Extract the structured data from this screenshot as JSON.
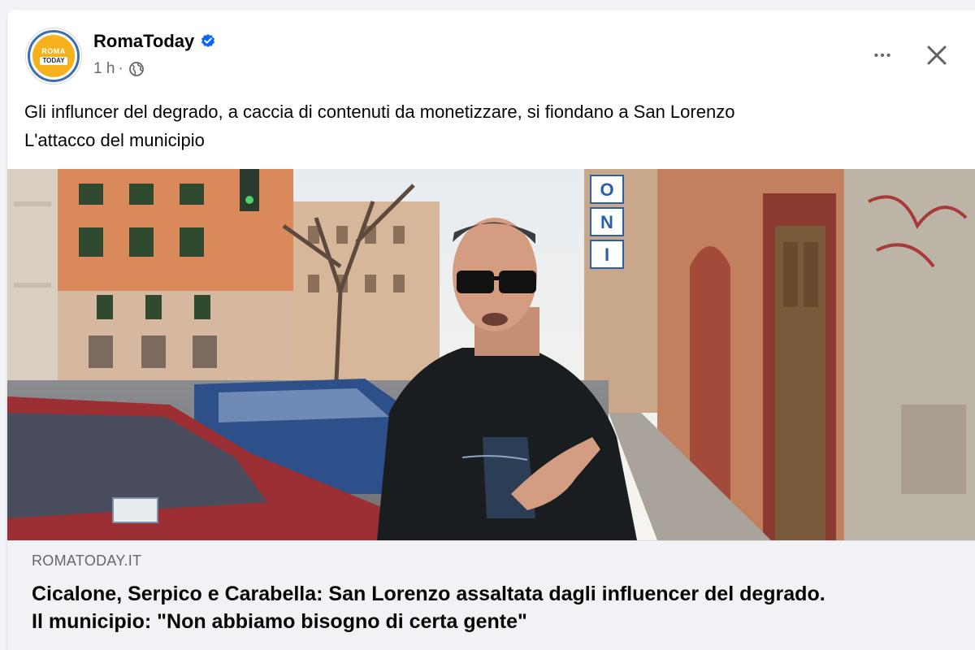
{
  "post": {
    "page_name": "RomaToday",
    "verified_icon": "verified-badge-icon",
    "time": "1 h",
    "separator": "·",
    "audience_icon": "globe-icon",
    "more_icon": "more-options-icon",
    "more_label": "•••",
    "close_icon": "close-icon",
    "caption_line1": "Gli influncer del degrado, a caccia di contenuti da monetizzare, si fiondano a San Lorenzo",
    "caption_line2": "L'attacco del municipio"
  },
  "avatar": {
    "logo_top": "ROMA",
    "logo_bottom": "TODAY"
  },
  "photo": {
    "sign_letters": [
      "O",
      "N",
      "I"
    ]
  },
  "link_preview": {
    "domain": "ROMATODAY.IT",
    "headline_line1": "Cicalone, Serpico e Carabella: San Lorenzo assaltata dagli influencer del degrado.",
    "headline_line2": "Il municipio: \"Non abbiamo bisogno di certa gente\""
  },
  "colors": {
    "verified_blue": "#0866ff",
    "logo_yellow": "#f6b21c",
    "secondary_text": "#65676b",
    "link_bar_bg": "#f0f2f5"
  }
}
